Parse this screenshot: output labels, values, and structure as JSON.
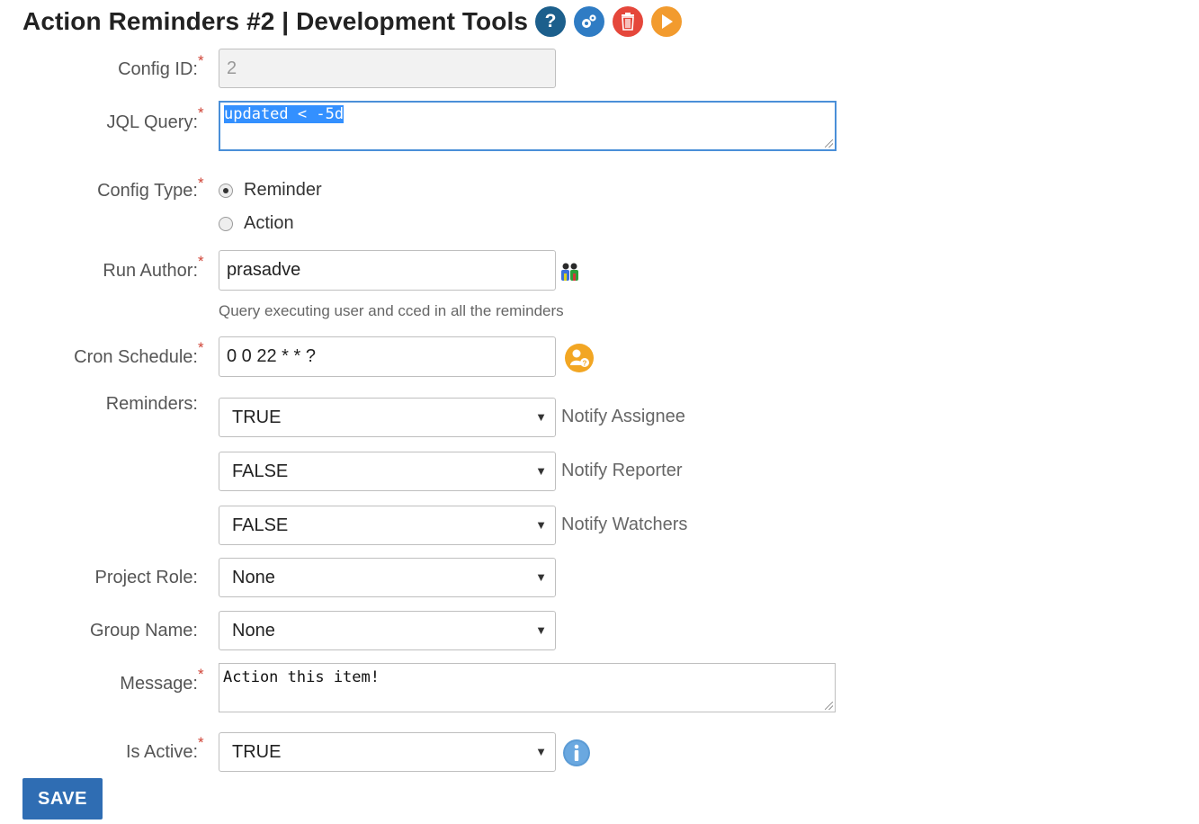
{
  "header": {
    "title": "Action Reminders #2 | Development Tools",
    "icons": [
      "help-icon",
      "settings-gear-icon",
      "delete-trash-icon",
      "run-play-icon"
    ]
  },
  "form": {
    "config_id": {
      "label": "Config ID:",
      "value": "2"
    },
    "jql_query": {
      "label": "JQL Query:",
      "value": "updated < -5d"
    },
    "config_type": {
      "label": "Config Type:",
      "options": [
        "Reminder",
        "Action"
      ],
      "selected": "Reminder"
    },
    "run_author": {
      "label": "Run Author:",
      "value": "prasadve",
      "hint": "Query executing user and cced in all the reminders"
    },
    "cron_schedule": {
      "label": "Cron Schedule:",
      "value": "0 0 22 * * ?"
    },
    "reminders": {
      "label": "Reminders:",
      "items": [
        {
          "value": "TRUE",
          "label": "Notify Assignee"
        },
        {
          "value": "FALSE",
          "label": "Notify Reporter"
        },
        {
          "value": "FALSE",
          "label": "Notify Watchers"
        }
      ]
    },
    "project_role": {
      "label": "Project Role:",
      "value": "None"
    },
    "group_name": {
      "label": "Group Name:",
      "value": "None"
    },
    "message": {
      "label": "Message:",
      "value": "Action this item!"
    },
    "is_active": {
      "label": "Is Active:",
      "value": "TRUE"
    },
    "required_mark": "*",
    "dropdown_caret": "▼",
    "save_label": "SAVE"
  },
  "colors": {
    "required": "#d04437",
    "save_button": "#2f6db3",
    "selection": "#3390ff",
    "focus_border": "#4a8fd8"
  }
}
